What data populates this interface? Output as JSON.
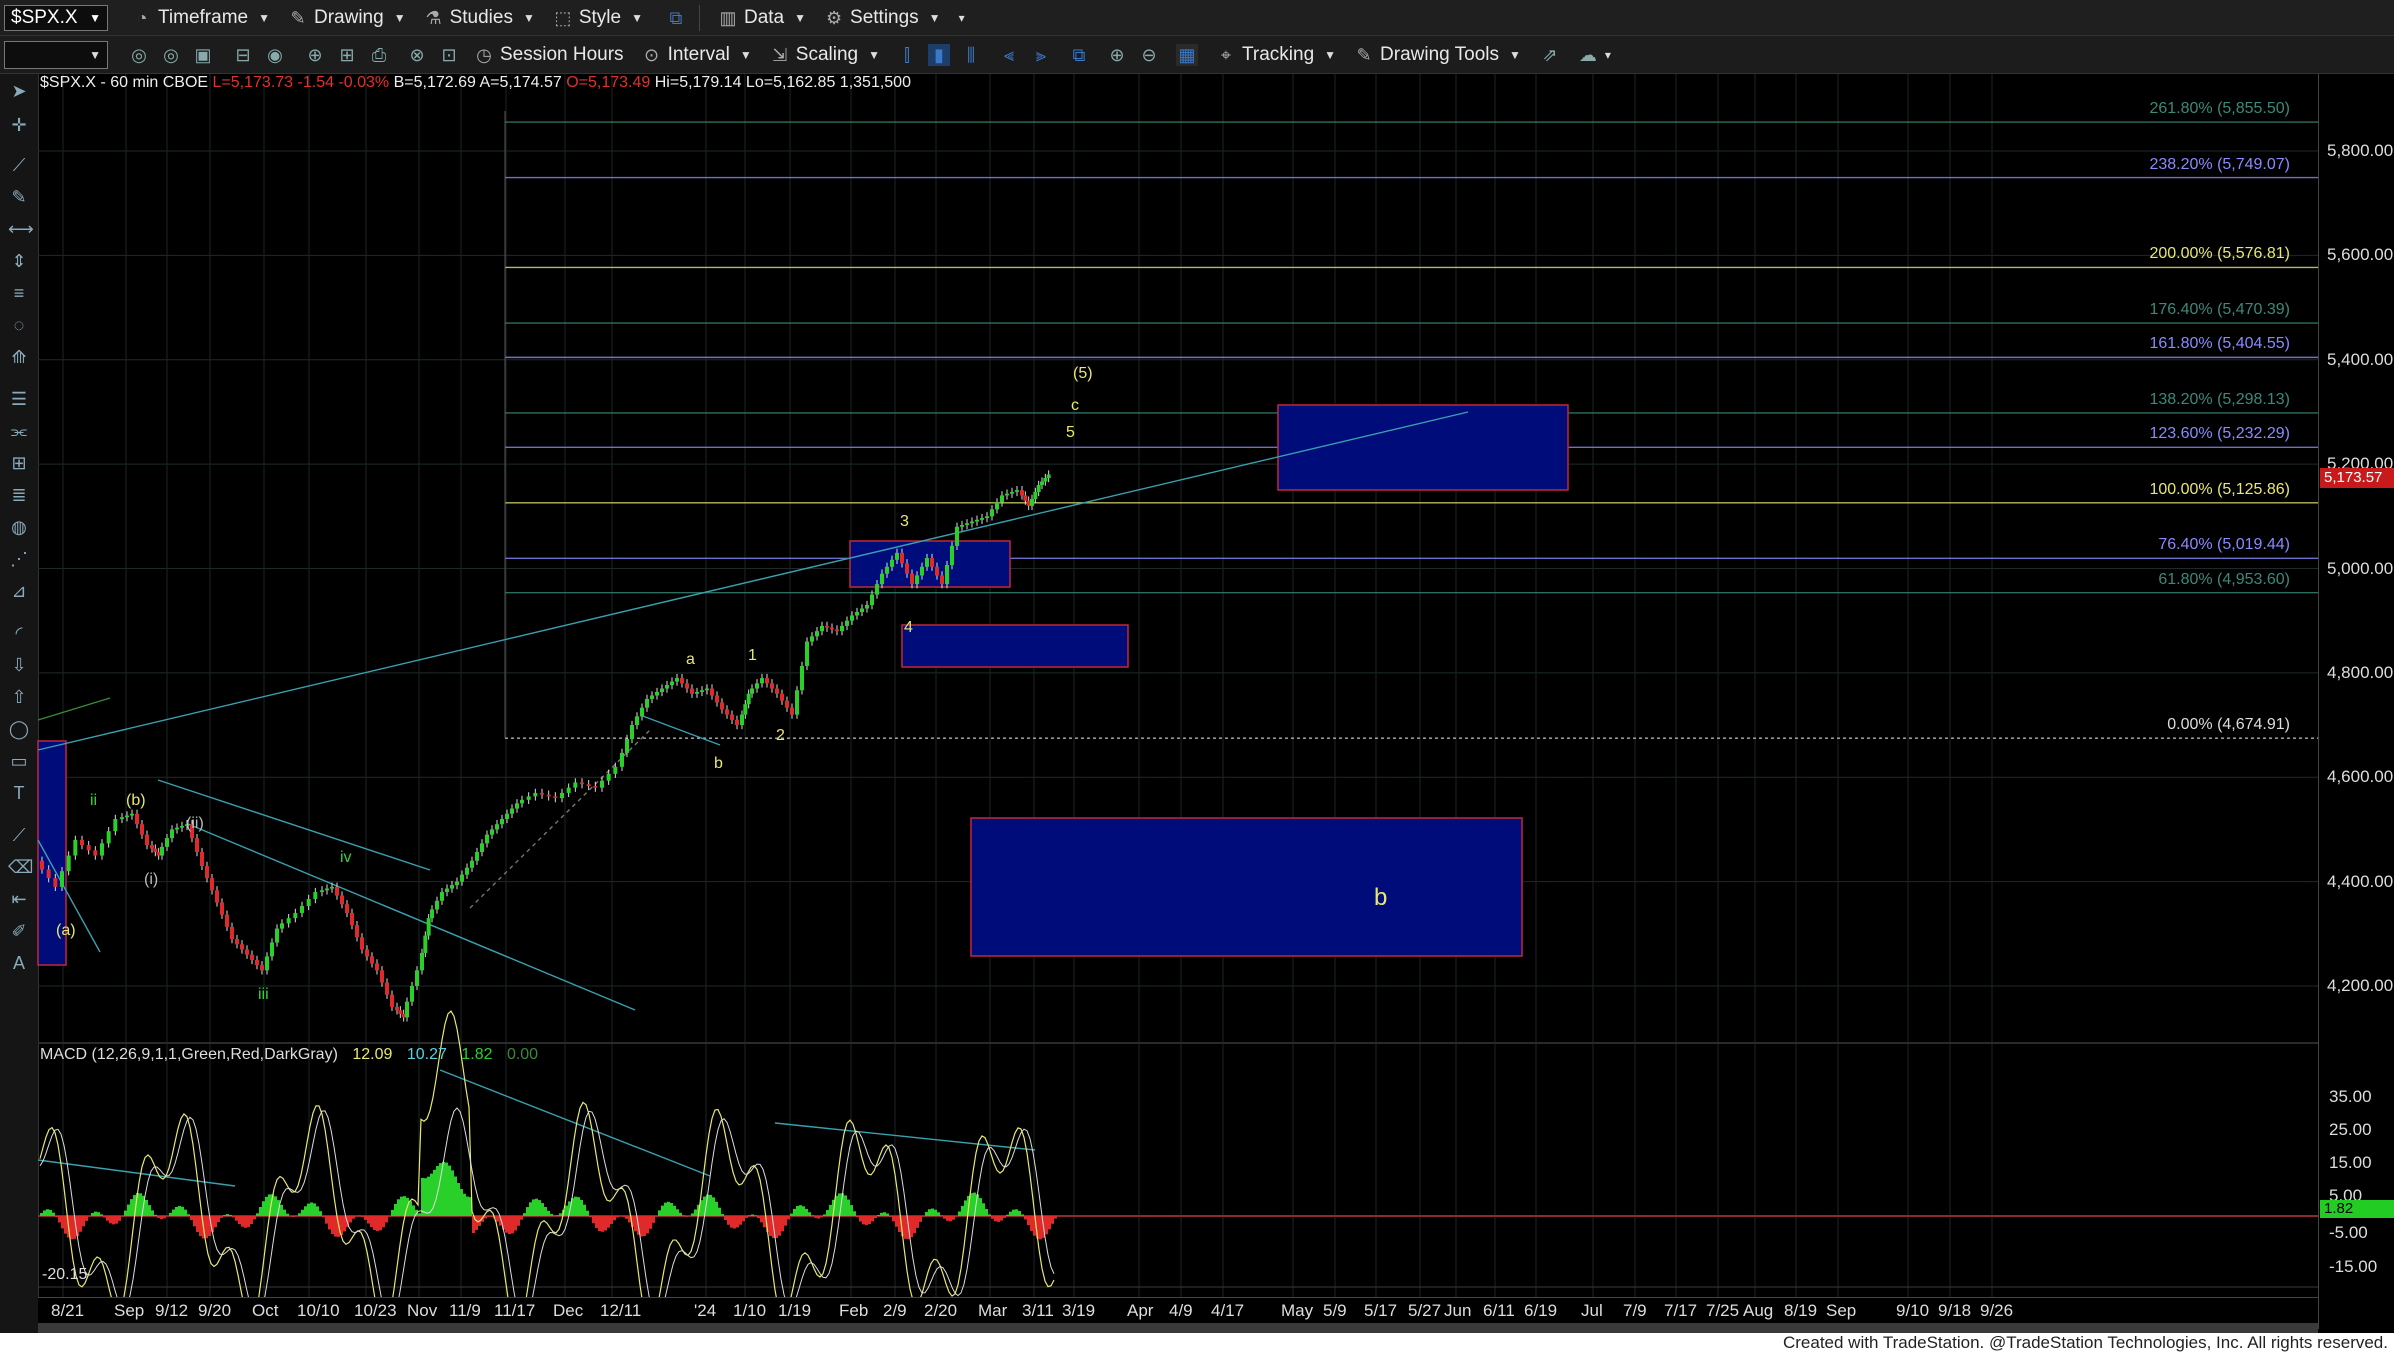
{
  "toolbar1": {
    "symbol": "$SPX.X",
    "menus": [
      "Timeframe",
      "Drawing",
      "Studies",
      "Style",
      "Data",
      "Settings"
    ]
  },
  "toolbar2": {
    "session_hours": "Session Hours",
    "interval": "Interval",
    "scaling": "Scaling",
    "tracking": "Tracking",
    "drawing_tools": "Drawing Tools"
  },
  "chart_data": {
    "type": "candlestick",
    "symbol_line": {
      "symbol": "$SPX.X - 60 min",
      "exchange": "CBOE",
      "last": "L=5,173.73",
      "change": "-1.54",
      "change_pct": "-0.03%",
      "bid": "B=5,172.69",
      "ask": "A=5,174.57",
      "open": "O=5,173.49",
      "high": "Hi=5,179.14",
      "low": "Lo=5,162.85",
      "volume": "1,351,500"
    },
    "last_price_tag": "5,173.57",
    "y_axis": {
      "ticks": [
        "5,800.00",
        "5,600.00",
        "5,400.00",
        "5,200.00",
        "5,000.00",
        "4,800.00",
        "4,600.00",
        "4,400.00",
        "4,200.00"
      ],
      "range": [
        4130,
        5880
      ]
    },
    "x_axis": {
      "ticks": [
        "8/21",
        "Sep",
        "9/12",
        "9/20",
        "Oct",
        "10/10",
        "10/23",
        "Nov",
        "11/9",
        "11/17",
        "Dec",
        "12/11",
        "'24",
        "1/10",
        "1/19",
        "Feb",
        "2/9",
        "2/20",
        "Mar",
        "3/11",
        "3/19",
        "Apr",
        "4/9",
        "4/17",
        "May",
        "5/9",
        "5/17",
        "5/27",
        "Jun",
        "6/11",
        "6/19",
        "Jul",
        "7/9",
        "7/17",
        "7/25",
        "Aug",
        "8/19",
        "Sep",
        "9/10",
        "9/18",
        "9/26"
      ]
    },
    "fib_levels": [
      {
        "label": "261.80% (5,855.50)",
        "value": 5855.5,
        "color": "#3a8a7a"
      },
      {
        "label": "238.20% (5,749.07)",
        "value": 5749.07,
        "color": "#8a8aff"
      },
      {
        "label": "200.00% (5,576.81)",
        "value": 5576.81,
        "color": "#e8e870"
      },
      {
        "label": "176.40% (5,470.39)",
        "value": 5470.39,
        "color": "#3a8a7a"
      },
      {
        "label": "161.80% (5,404.55)",
        "value": 5404.55,
        "color": "#8a8aff"
      },
      {
        "label": "138.20% (5,298.13)",
        "value": 5298.13,
        "color": "#3a8a7a"
      },
      {
        "label": "123.60% (5,232.29)",
        "value": 5232.29,
        "color": "#8a8aff"
      },
      {
        "label": "100.00% (5,125.86)",
        "value": 5125.86,
        "color": "#e8e870"
      },
      {
        "label": "76.40% (5,019.44)",
        "value": 5019.44,
        "color": "#8a8aff"
      },
      {
        "label": "61.80% (4,953.60)",
        "value": 4953.6,
        "color": "#3a8a7a"
      },
      {
        "label": "0.00% (4,674.91)",
        "value": 4674.91,
        "color": "#dddddd"
      }
    ],
    "wave_labels": [
      "(5)",
      "c",
      "5",
      "3",
      "4",
      "a",
      "1",
      "b",
      "2",
      "ii",
      "(b)",
      "(ii)",
      "(i)",
      "iv",
      "iii",
      "(a)",
      "b"
    ],
    "macd": {
      "title": "MACD (12,26,9,1,1,Green,Red,DarkGray)",
      "v1": "12.09",
      "v2": "10.27",
      "v3": "1.82",
      "v4": "0.00",
      "ticks": [
        "35.00",
        "25.00",
        "15.00",
        "5.00",
        "-5.00",
        "-15.00"
      ],
      "last_tag": "1.82",
      "min_label": "-20.15"
    }
  },
  "footer": "Created with TradeStation. @TradeStation Technologies, Inc. All rights reserved."
}
